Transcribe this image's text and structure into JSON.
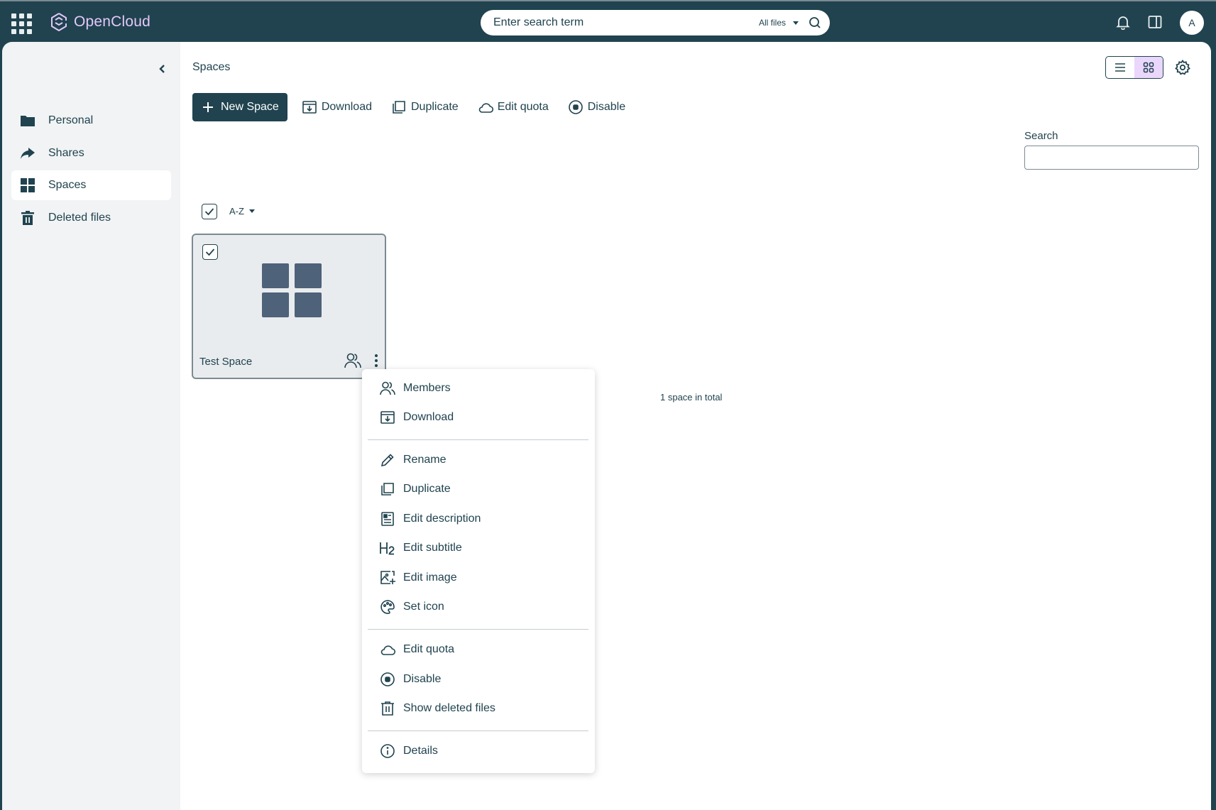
{
  "app": {
    "name": "OpenCloud",
    "brand_color": "#e3c8f8",
    "header_bg": "#20434f"
  },
  "header": {
    "search_placeholder": "Enter search term",
    "search_scope": "All files",
    "avatar_initial": "A",
    "icons": [
      "apps-grid-icon",
      "opencloud-logo-icon",
      "search-icon",
      "bell-icon",
      "sidebar-panel-icon"
    ]
  },
  "sidebar": {
    "items": [
      {
        "label": "Personal",
        "icon": "folder-icon"
      },
      {
        "label": "Shares",
        "icon": "share-arrow-icon"
      },
      {
        "label": "Spaces",
        "icon": "spaces-grid-icon",
        "active": true
      },
      {
        "label": "Deleted files",
        "icon": "trash-icon"
      }
    ]
  },
  "main": {
    "title": "Spaces",
    "toolbar": {
      "new_space": "New Space",
      "download": "Download",
      "duplicate": "Duplicate",
      "edit_quota": "Edit quota",
      "disable": "Disable"
    },
    "filter": {
      "label": "Search",
      "value": ""
    },
    "sort_label": "A-Z",
    "spaces": [
      {
        "name": "Test Space",
        "selected": true
      }
    ],
    "total": "1 space in total"
  },
  "context_menu": {
    "groups": [
      [
        {
          "label": "Members",
          "icon": "members-icon"
        },
        {
          "label": "Download",
          "icon": "download-icon"
        }
      ],
      [
        {
          "label": "Rename",
          "icon": "pencil-icon"
        },
        {
          "label": "Duplicate",
          "icon": "duplicate-icon"
        },
        {
          "label": "Edit description",
          "icon": "description-icon"
        },
        {
          "label": "Edit subtitle",
          "icon": "heading-icon"
        },
        {
          "label": "Edit image",
          "icon": "image-add-icon"
        },
        {
          "label": "Set icon",
          "icon": "palette-icon"
        }
      ],
      [
        {
          "label": "Edit quota",
          "icon": "cloud-icon"
        },
        {
          "label": "Disable",
          "icon": "stop-circle-icon"
        },
        {
          "label": "Show deleted files",
          "icon": "trash-icon"
        }
      ],
      [
        {
          "label": "Details",
          "icon": "info-icon"
        }
      ]
    ]
  }
}
